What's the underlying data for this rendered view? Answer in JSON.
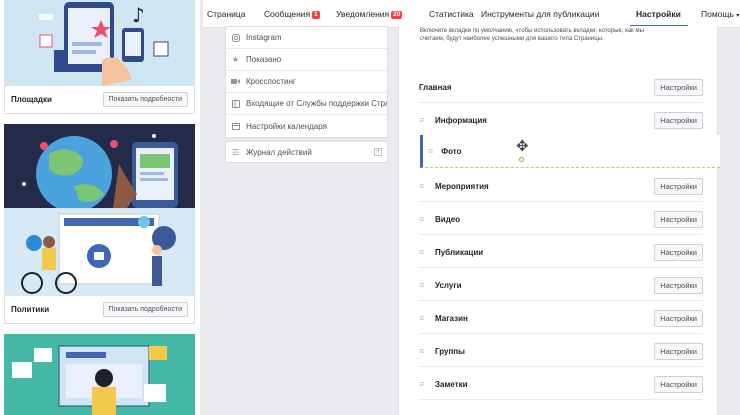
{
  "cards": [
    {
      "title": "Площадки",
      "button": "Показать подробности"
    },
    {
      "title": "",
      "button": ""
    },
    {
      "title": "Политики",
      "button": "Показать подробности"
    },
    {
      "title": "",
      "button": ""
    }
  ],
  "nav": {
    "items": [
      "Страница",
      "Сообщения",
      "Уведомления",
      "Статистика",
      "Инструменты для публикации",
      "Настройки",
      "Помощь"
    ],
    "messages_badge": "1",
    "notifications_badge": "20"
  },
  "menu": {
    "items": [
      {
        "label": "Instagram",
        "icon": "instagram-icon"
      },
      {
        "label": "Показано",
        "icon": "star-icon"
      },
      {
        "label": "Кросспостинг",
        "icon": "video-icon"
      },
      {
        "label": "Входящие от Службы поддержки Страни",
        "icon": "inbox-icon"
      },
      {
        "label": "Настройки календаря",
        "icon": "calendar-icon"
      }
    ],
    "activity_log": "Журнал действий"
  },
  "tabs_panel": {
    "description": "Включите вкладки по умолчанию, чтобы использовать вкладки, которые, как мы считаем, будут наиболее успешными для вашего типа Страницы.",
    "settings_label": "Настройки",
    "home": "Главная",
    "dragging_tab": "Фото",
    "tabs": [
      "Информация",
      "Мероприятия",
      "Видео",
      "Публикации",
      "Услуги",
      "Магазин",
      "Группы",
      "Заметки"
    ]
  },
  "colors": {
    "accent": "#4267b2",
    "badge": "#fa3e3e",
    "background": "#e9ebee"
  }
}
